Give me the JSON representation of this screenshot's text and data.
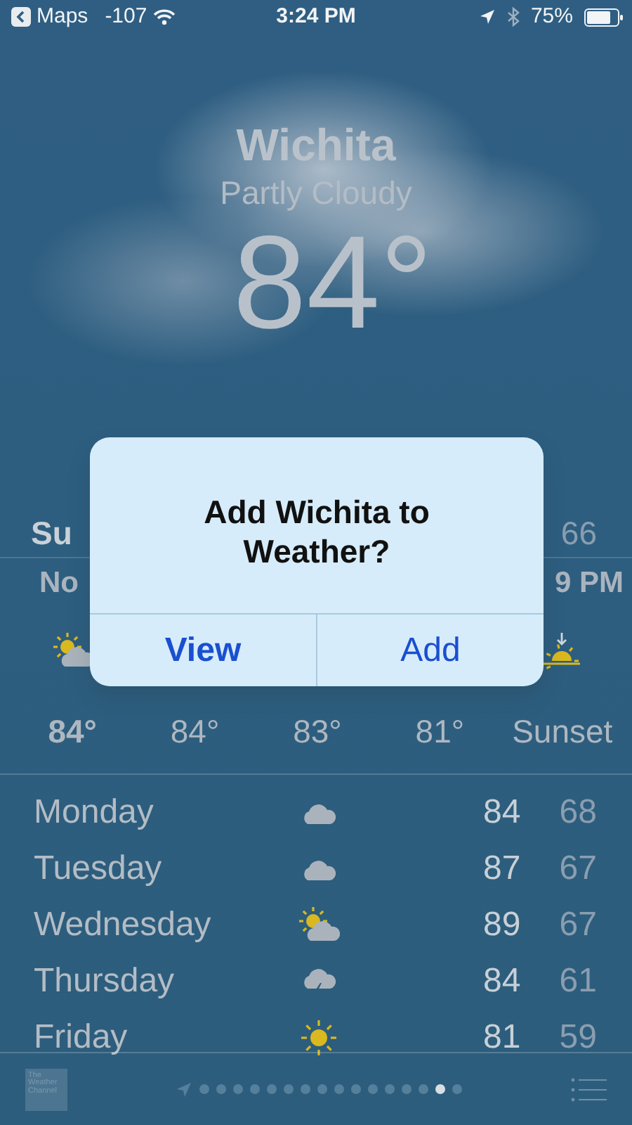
{
  "status_bar": {
    "back_label": "Maps",
    "signal": "-107",
    "time": "3:24 PM",
    "battery": "75%"
  },
  "location": {
    "city": "Wichita",
    "condition": "Partly Cloudy",
    "temperature": "84°"
  },
  "today": {
    "day": "Su",
    "low": "66"
  },
  "hourly": [
    {
      "time": "No",
      "kind": "partly-sunny",
      "temp": "84°"
    },
    {
      "temp": "84°"
    },
    {
      "temp": "83°"
    },
    {
      "temp": "81°"
    },
    {
      "time": "9 PM",
      "kind": "sunset",
      "temp": "Sunset"
    }
  ],
  "daily": [
    {
      "day": "Monday",
      "kind": "cloud",
      "high": "84",
      "low": "68"
    },
    {
      "day": "Tuesday",
      "kind": "cloud",
      "high": "87",
      "low": "67"
    },
    {
      "day": "Wednesday",
      "kind": "partly-sunny",
      "high": "89",
      "low": "67"
    },
    {
      "day": "Thursday",
      "kind": "storm",
      "high": "84",
      "low": "61"
    },
    {
      "day": "Friday",
      "kind": "sun",
      "high": "81",
      "low": "59"
    }
  ],
  "alert": {
    "title": "Add Wichita to Weather?",
    "buttons": [
      {
        "label": "View",
        "preferred": true
      },
      {
        "label": "Add",
        "preferred": false
      }
    ]
  },
  "footer": {
    "logo": "The Weather Channel",
    "pages": [
      {
        "selected": false
      },
      {
        "selected": false
      },
      {
        "selected": false
      },
      {
        "selected": false
      },
      {
        "selected": false
      },
      {
        "selected": false
      },
      {
        "selected": false
      },
      {
        "selected": false
      },
      {
        "selected": false
      },
      {
        "selected": false
      },
      {
        "selected": false
      },
      {
        "selected": false
      },
      {
        "selected": false
      },
      {
        "selected": false
      },
      {
        "selected": true
      },
      {
        "selected": false
      }
    ]
  }
}
